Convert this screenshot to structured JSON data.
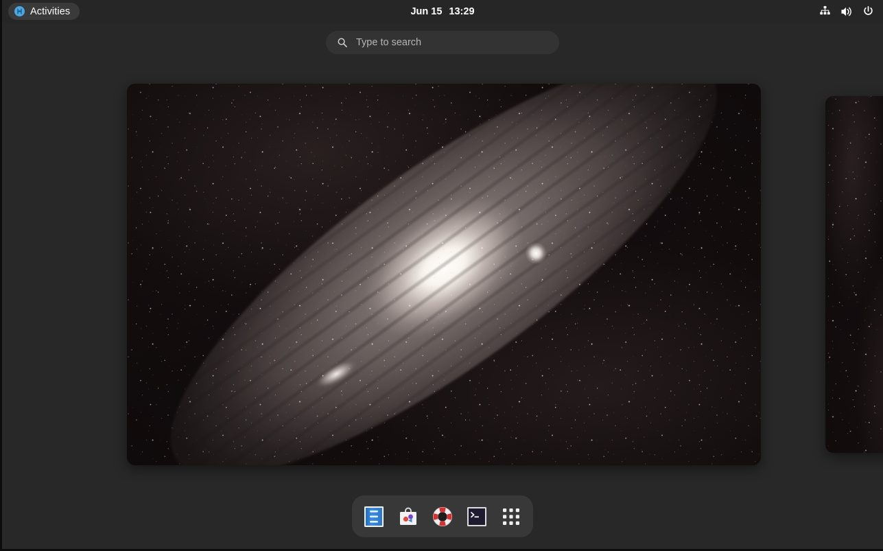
{
  "desktop": {
    "environment": "GNOME Shell Activities Overview",
    "background_color": "#282828"
  },
  "topbar": {
    "activities": {
      "label": "Activities",
      "icon": "gnome-logo-icon",
      "accent_color": "#4aa8e8",
      "pill_color": "#3a3a3a"
    },
    "clock": {
      "date": "Jun 15",
      "time": "13:29"
    },
    "status_icons": [
      {
        "name": "network-wired-icon",
        "label": "Network"
      },
      {
        "name": "volume-speaker-icon",
        "label": "Volume"
      },
      {
        "name": "power-icon",
        "label": "Power"
      }
    ]
  },
  "search": {
    "icon": "search-icon",
    "placeholder": "Type to search",
    "value": ""
  },
  "workspaces": {
    "active_index": 0,
    "items": [
      {
        "name": "workspace-1",
        "label": "Workspace 1",
        "wallpaper": "Andromeda Galaxy",
        "active": true
      },
      {
        "name": "workspace-2",
        "label": "Workspace 2",
        "wallpaper": "Andromeda Galaxy",
        "active": false
      }
    ]
  },
  "dash": {
    "background_color": "#383838",
    "items": [
      {
        "name": "dash-item-files",
        "label": "Files",
        "icon": "file-cabinet-icon"
      },
      {
        "name": "dash-item-software",
        "label": "Software",
        "icon": "shopping-bag-icon"
      },
      {
        "name": "dash-item-help",
        "label": "Help",
        "icon": "life-ring-icon"
      },
      {
        "name": "dash-item-terminal",
        "label": "Terminal",
        "icon": "terminal-icon"
      },
      {
        "name": "dash-item-show-apps",
        "label": "Show Applications",
        "icon": "grid-dots-icon"
      }
    ]
  }
}
